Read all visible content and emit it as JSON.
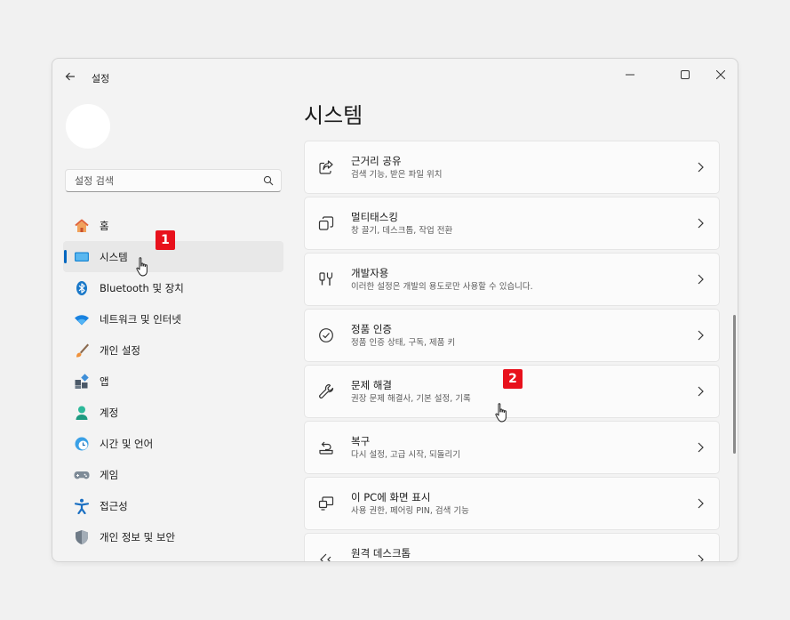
{
  "window": {
    "title": "설정"
  },
  "search": {
    "placeholder": "설정 검색"
  },
  "nav": {
    "items": [
      {
        "label": "홈",
        "icon": "home-icon",
        "active": false
      },
      {
        "label": "시스템",
        "icon": "system-icon",
        "active": true
      },
      {
        "label": "Bluetooth 및 장치",
        "icon": "bluetooth-icon",
        "active": false
      },
      {
        "label": "네트워크 및 인터넷",
        "icon": "wifi-icon",
        "active": false
      },
      {
        "label": "개인 설정",
        "icon": "brush-icon",
        "active": false
      },
      {
        "label": "앱",
        "icon": "apps-icon",
        "active": false
      },
      {
        "label": "계정",
        "icon": "account-icon",
        "active": false
      },
      {
        "label": "시간 및 언어",
        "icon": "clock-globe-icon",
        "active": false
      },
      {
        "label": "게임",
        "icon": "gamepad-icon",
        "active": false
      },
      {
        "label": "접근성",
        "icon": "accessibility-icon",
        "active": false
      },
      {
        "label": "개인 정보 및 보안",
        "icon": "shield-icon",
        "active": false
      }
    ]
  },
  "main": {
    "title": "시스템",
    "cards": [
      {
        "title": "근거리 공유",
        "subtitle": "검색 기능, 받은 파일 위치",
        "icon": "share-icon"
      },
      {
        "title": "멀티태스킹",
        "subtitle": "창 끌기, 데스크톱, 작업 전환",
        "icon": "multitask-icon"
      },
      {
        "title": "개발자용",
        "subtitle": "이러한 설정은 개발의 용도로만 사용할 수 있습니다.",
        "icon": "developer-tools-icon"
      },
      {
        "title": "정품 인증",
        "subtitle": "정품 인증 상태, 구독, 제품 키",
        "icon": "check-circle-icon"
      },
      {
        "title": "문제 해결",
        "subtitle": "권장 문제 해결사, 기본 설정, 기록",
        "icon": "wrench-icon"
      },
      {
        "title": "복구",
        "subtitle": "다시 설정, 고급 시작, 되돌리기",
        "icon": "recovery-icon"
      },
      {
        "title": "이 PC에 화면 표시",
        "subtitle": "사용 권한, 페어링 PIN, 검색 기능",
        "icon": "project-to-pc-icon"
      },
      {
        "title": "원격 데스크톱",
        "subtitle": "",
        "icon": "remote-desktop-icon"
      }
    ]
  },
  "annotations": {
    "badge1": "1",
    "badge2": "2"
  },
  "colors": {
    "accent": "#0067c0",
    "badge": "#e8111c"
  }
}
